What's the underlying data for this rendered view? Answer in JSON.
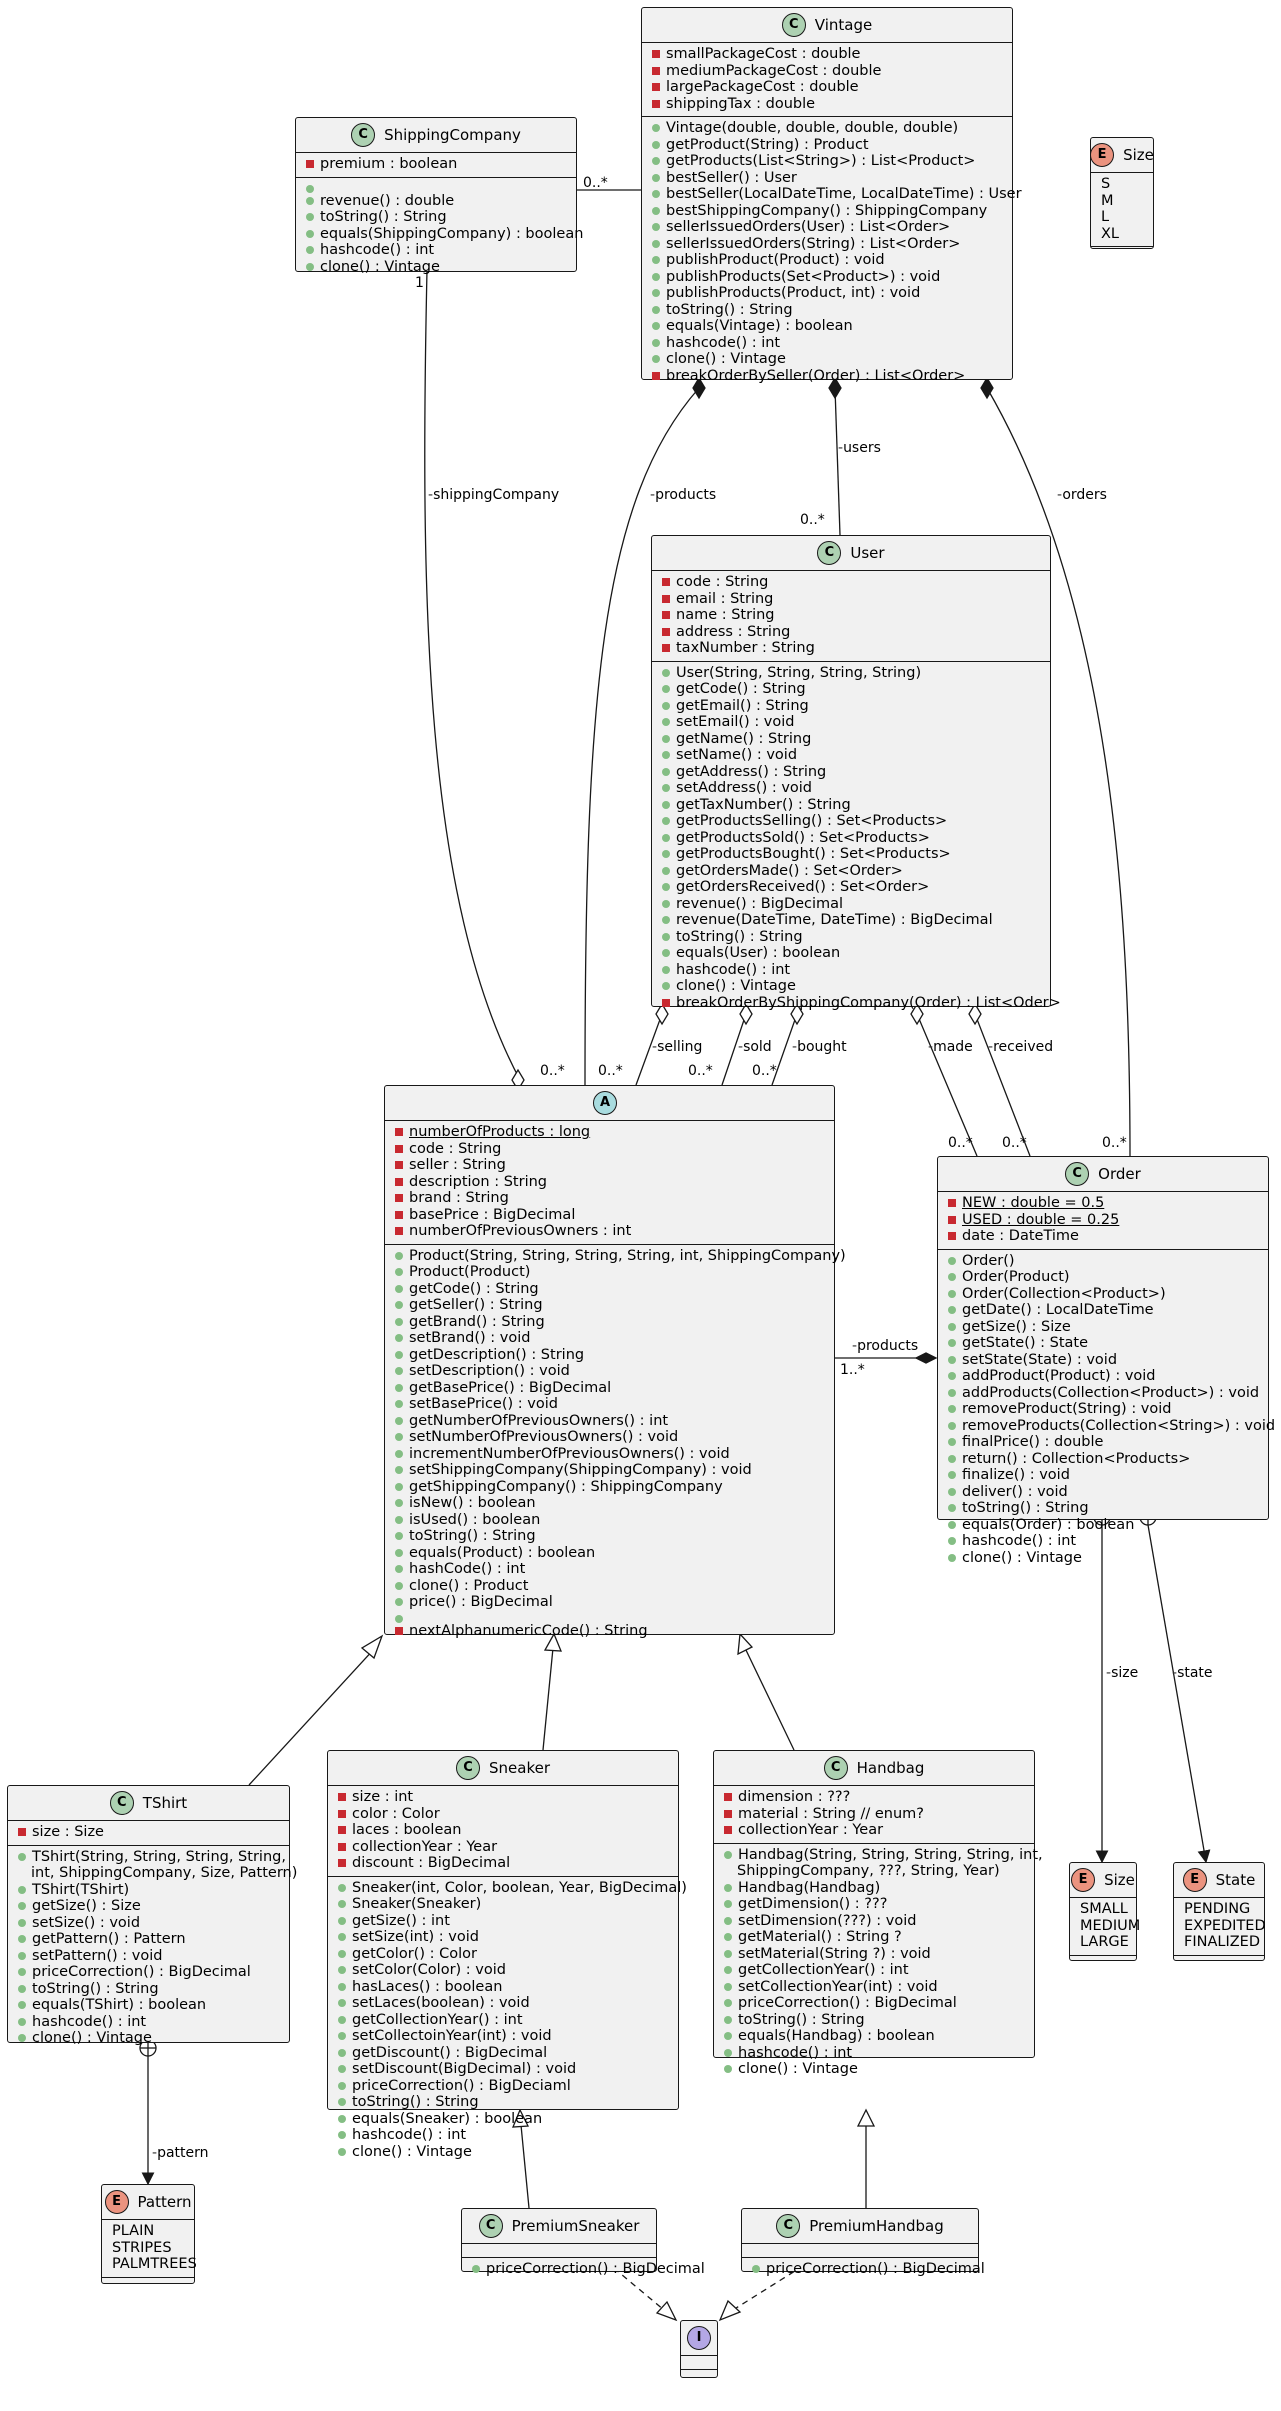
{
  "classes": {
    "vintage": {
      "name": "Vintage",
      "fields": [
        "smallPackageCost : double",
        "mediumPackageCost : double",
        "largePackageCost : double",
        "shippingTax : double"
      ],
      "methods": [
        "Vintage(double, double, double, double)",
        "getProduct(String) : Product",
        "getProducts(List<String>) : List<Product>",
        "bestSeller() : User",
        "bestSeller(LocalDateTime, LocalDateTime) : User",
        "bestShippingCompany() : ShippingCompany",
        "sellerIssuedOrders(User) : List<Order>",
        "sellerIssuedOrders(String) : List<Order>",
        "publishProduct(Product) : void",
        "publishProducts(Set<Product>) : void",
        "publishProducts(Product, int) : void",
        "toString() : String",
        "equals(Vintage) : boolean",
        "hashcode() : int",
        "clone() : Vintage",
        "breakOrderBySeller(Order) : List<Order>"
      ]
    },
    "shipping": {
      "name": "ShippingCompany",
      "fields": [
        "premium : boolean"
      ],
      "methods": [
        "",
        "revenue() : double",
        "toString() : String",
        "equals(ShippingCompany) : boolean",
        "hashcode() : int",
        "clone() : Vintage"
      ]
    },
    "user": {
      "name": "User",
      "fields": [
        "code : String",
        "email : String",
        "name : String",
        "address : String",
        "taxNumber : String"
      ],
      "methods": [
        "User(String, String, String, String)",
        "getCode() : String",
        "getEmail() : String",
        "setEmail() : void",
        "getName() : String",
        "setName() : void",
        "getAddress() : String",
        "setAddress() : void",
        "getTaxNumber() : String",
        "getProductsSelling() : Set<Products>",
        "getProductsSold() : Set<Products>",
        "getProductsBought() : Set<Products>",
        "getOrdersMade() : Set<Order>",
        "getOrdersReceived() : Set<Order>",
        "revenue() : BigDecimal",
        "revenue(DateTime, DateTime) : BigDecimal",
        "toString() : String",
        "equals(User) : boolean",
        "hashcode() : int",
        "clone() : Vintage",
        "breakOrderByShippingCompany(Order) : List<Oder>"
      ]
    },
    "product": {
      "name": "",
      "fields": [
        "numberOfProducts : long",
        "code : String",
        "seller : String",
        "description : String",
        "brand : String",
        "basePrice : BigDecimal",
        "numberOfPreviousOwners : int"
      ],
      "methods": [
        "Product(String, String, String, String, int, ShippingCompany)",
        "Product(Product)",
        "getCode() : String",
        "getSeller() : String",
        "getBrand() : String",
        "setBrand() : void",
        "getDescription() : String",
        "setDescription() : void",
        "getBasePrice() : BigDecimal",
        "setBasePrice() : void",
        "getNumberOfPreviousOwners() : int",
        "setNumberOfPreviousOwners() : void",
        "incrementNumberOfPreviousOwners() : void",
        "setShippingCompany(ShippingCompany) : void",
        "getShippingCompany() : ShippingCompany",
        "isNew() : boolean",
        "isUsed() : boolean",
        "toString() : String",
        "equals(Product) : boolean",
        "hashCode() : int",
        "clone() : Product",
        "price() : BigDecimal",
        "",
        "nextAlphanumericCode() : String"
      ]
    },
    "order": {
      "name": "Order",
      "fields": [
        "NEW : double = 0.5",
        "USED : double = 0.25",
        "date : DateTime"
      ],
      "methods": [
        "Order()",
        "Order(Product)",
        "Order(Collection<Product>)",
        "getDate() : LocalDateTime",
        "getSize() : Size",
        "getState() : State",
        "setState(State) : void",
        "addProduct(Product) : void",
        "addProducts(Collection<Product>) : void",
        "removeProduct(String) : void",
        "removeProducts(Collection<String>) : void",
        "finalPrice() : double",
        "return() : Collection<Products>",
        "finalize() : void",
        "deliver() : void",
        "toString() : String",
        "equals(Order) : boolean",
        "hashcode() : int",
        "clone() : Vintage"
      ]
    },
    "tshirt": {
      "name": "TShirt",
      "fields": [
        "size : Size"
      ],
      "methods": [
        "TShirt(String, String, String, String,",
        "int, ShippingCompany, Size, Pattern)",
        "TShirt(TShirt)",
        "getSize() : Size",
        "setSize() : void",
        "getPattern() : Pattern",
        "setPattern() : void",
        "priceCorrection() : BigDecimal",
        "toString() : String",
        "equals(TShirt) : boolean",
        "hashcode() : int",
        "clone() : Vintage"
      ]
    },
    "sneaker": {
      "name": "Sneaker",
      "fields": [
        "size : int",
        "color : Color",
        "laces : boolean",
        "collectionYear : Year",
        "discount : BigDecimal"
      ],
      "methods": [
        "Sneaker(int, Color, boolean, Year, BigDecimal)",
        "Sneaker(Sneaker)",
        "getSize() : int",
        "setSize(int) : void",
        "getColor() : Color",
        "setColor(Color) : void",
        "hasLaces() : boolean",
        "setLaces(boolean) : void",
        "getCollectionYear() : int",
        "setCollectoinYear(int) : void",
        "getDiscount() : BigDecimal",
        "setDiscount(BigDecimal) : void",
        "priceCorrection() : BigDeciaml",
        "toString() : String",
        "equals(Sneaker) : boolean",
        "hashcode() : int",
        "clone() : Vintage"
      ]
    },
    "handbag": {
      "name": "Handbag",
      "fields": [
        "dimension : ???",
        "material : String // enum?",
        "collectionYear : Year"
      ],
      "methods": [
        "Handbag(String, String, String, String, int,",
        "ShippingCompany, ???, String, Year)",
        "Handbag(Handbag)",
        "getDimension() : ???",
        "setDimension(???) : void",
        "getMaterial() : String ?",
        "setMaterial(String ?) : void",
        "getCollectionYear() : int",
        "setCollectionYear(int) : void",
        "priceCorrection() : BigDecimal",
        "toString() : String",
        "equals(Handbag) : boolean",
        "hashcode() : int",
        "clone() : Vintage"
      ]
    },
    "premiumSneaker": {
      "name": "PremiumSneaker",
      "methods": [
        "priceCorrection() : BigDecimal"
      ]
    },
    "premiumHandbag": {
      "name": "PremiumHandbag",
      "methods": [
        "priceCorrection() : BigDecimal"
      ]
    },
    "iface": {
      "name": ""
    }
  },
  "enums": {
    "sizeTop": {
      "name": "Size",
      "values": [
        "S",
        "M",
        "L",
        "XL"
      ]
    },
    "sizeOrder": {
      "name": "Size",
      "values": [
        "SMALL",
        "MEDIUM",
        "LARGE"
      ]
    },
    "state": {
      "name": "State",
      "values": [
        "PENDING",
        "EXPEDITED",
        "FINALIZED"
      ]
    },
    "pattern": {
      "name": "Pattern",
      "values": [
        "PLAIN",
        "STRIPES",
        "PALMTREES"
      ]
    }
  },
  "edge_labels": {
    "shipVintageMult": "0..*",
    "shipVintageMultOne": "1",
    "shippingCompany": "shippingCompany",
    "products": "products",
    "users": "users",
    "orders": "orders",
    "usersMult": "0..*",
    "prodMultVintage": "0..*",
    "prodMultSelling": "0..*",
    "selling": "selling",
    "sold": "sold",
    "bought": "bought",
    "soldMult": "0..*",
    "boughtMult": "0..*",
    "made": "made",
    "received": "received",
    "madeMult": "0..*",
    "receivedMult": "0..*",
    "ordersMult": "0..*",
    "orderProducts": "products",
    "orderProductsMult": "1..*",
    "size": "size",
    "state": "state",
    "pattern": "pattern"
  },
  "badges": {
    "class": "C",
    "enum": "E",
    "abstract": "A",
    "interface": "I"
  },
  "colors": {
    "class": "#add1b2",
    "enum": "#eb937f",
    "abstract": "#a9dcdf",
    "interface": "#b4a7e5",
    "private": "#c82930",
    "public": "#84be84"
  }
}
